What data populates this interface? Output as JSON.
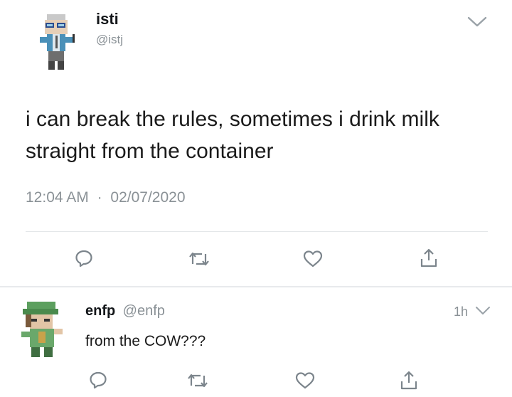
{
  "main_tweet": {
    "author_name": "isti",
    "handle": "@istj",
    "text": "i can break the rules, sometimes i drink milk straight from the container",
    "time": "12:04 AM",
    "separator": "·",
    "date": "02/07/2020",
    "avatar_icon": "pixel-character-avatar",
    "menu_icon": "chevron-down-icon",
    "actions": [
      "reply-icon",
      "retweet-icon",
      "like-icon",
      "share-icon"
    ]
  },
  "reply": {
    "author_name": "enfp",
    "handle": "@enfp",
    "text": "from the COW???",
    "time": "1h",
    "avatar_icon": "pixel-character-avatar",
    "menu_icon": "chevron-down-icon",
    "actions": [
      "reply-icon",
      "retweet-icon",
      "like-icon",
      "share-icon"
    ]
  },
  "colors": {
    "text": "#14171a",
    "secondary": "#8a9196",
    "divider": "#e3e6e8",
    "icon": "#7c858c"
  }
}
